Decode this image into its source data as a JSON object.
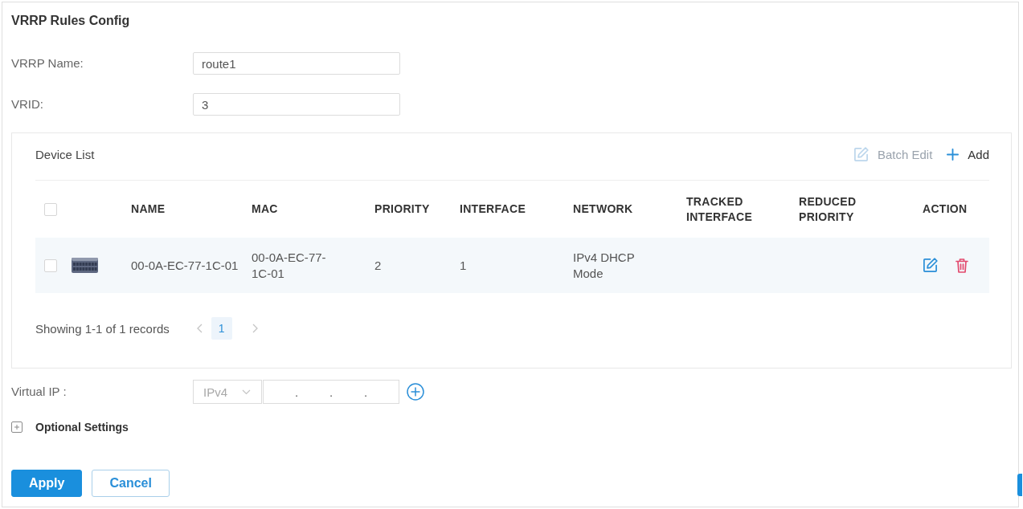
{
  "form": {
    "title": "VRRP Rules Config",
    "fields": [
      {
        "label": "VRRP Name:",
        "value": "route1"
      },
      {
        "label": "VRID:",
        "value": "3"
      }
    ]
  },
  "device_list": {
    "title": "Device List",
    "batch_edit": {
      "label": "Batch Edit",
      "disabled": true
    },
    "add": {
      "label": "Add"
    },
    "table": {
      "select_all": {
        "checked": false
      },
      "columns": [
        "NAME",
        "MAC",
        "PRIORITY",
        "INTERFACE",
        "NETWORK",
        "TRACKED INTERFACE",
        "REDUCED PRIORITY",
        "ACTION"
      ],
      "rows": [
        {
          "checked": false,
          "name": "00-0A-EC-77-1C-01",
          "mac": "00-0A-EC-77-1C-01",
          "priority": "2",
          "interface": "1",
          "network": "IPv4 DHCP Mode"
        }
      ]
    },
    "pagination": {
      "summary": "Showing 1-1 of 1 records",
      "pages": [
        {
          "label": "1",
          "selected": true
        }
      ]
    }
  },
  "virtual_ip": {
    "label": "Virtual IP :",
    "ip_version": "IPv4",
    "separators": [
      ".",
      ".",
      "."
    ]
  },
  "optional_settings": {
    "label": "Optional Settings",
    "expanded": false
  },
  "buttons": [
    {
      "label": "Apply",
      "kind": "primary"
    },
    {
      "label": "Cancel",
      "kind": "secondary"
    }
  ]
}
